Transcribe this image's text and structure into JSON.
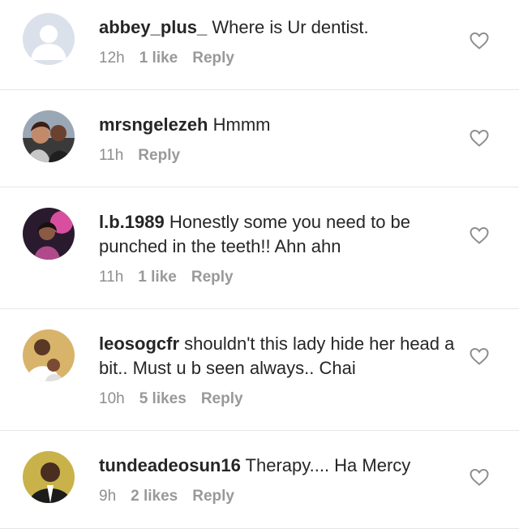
{
  "comments": [
    {
      "username": "abbey_plus_",
      "text": "Where is Ur dentist.",
      "time": "12h",
      "likes": "1 like",
      "reply": "Reply"
    },
    {
      "username": "mrsngelezeh",
      "text": "Hmmm",
      "time": "11h",
      "likes": "",
      "reply": "Reply"
    },
    {
      "username": "l.b.1989",
      "text": "Honestly some you need to be punched in the teeth!! Ahn ahn",
      "time": "11h",
      "likes": "1 like",
      "reply": "Reply"
    },
    {
      "username": "leosogcfr",
      "text": "shouldn't this lady hide her head a bit.. Must u b seen always.. Chai",
      "time": "10h",
      "likes": "5 likes",
      "reply": "Reply"
    },
    {
      "username": "tundeadeosun16",
      "text": "Therapy.... Ha Mercy",
      "time": "9h",
      "likes": "2 likes",
      "reply": "Reply"
    }
  ],
  "colors": {
    "text": "#262626",
    "meta": "#8e8e8e",
    "divider": "#e6e6e6"
  }
}
